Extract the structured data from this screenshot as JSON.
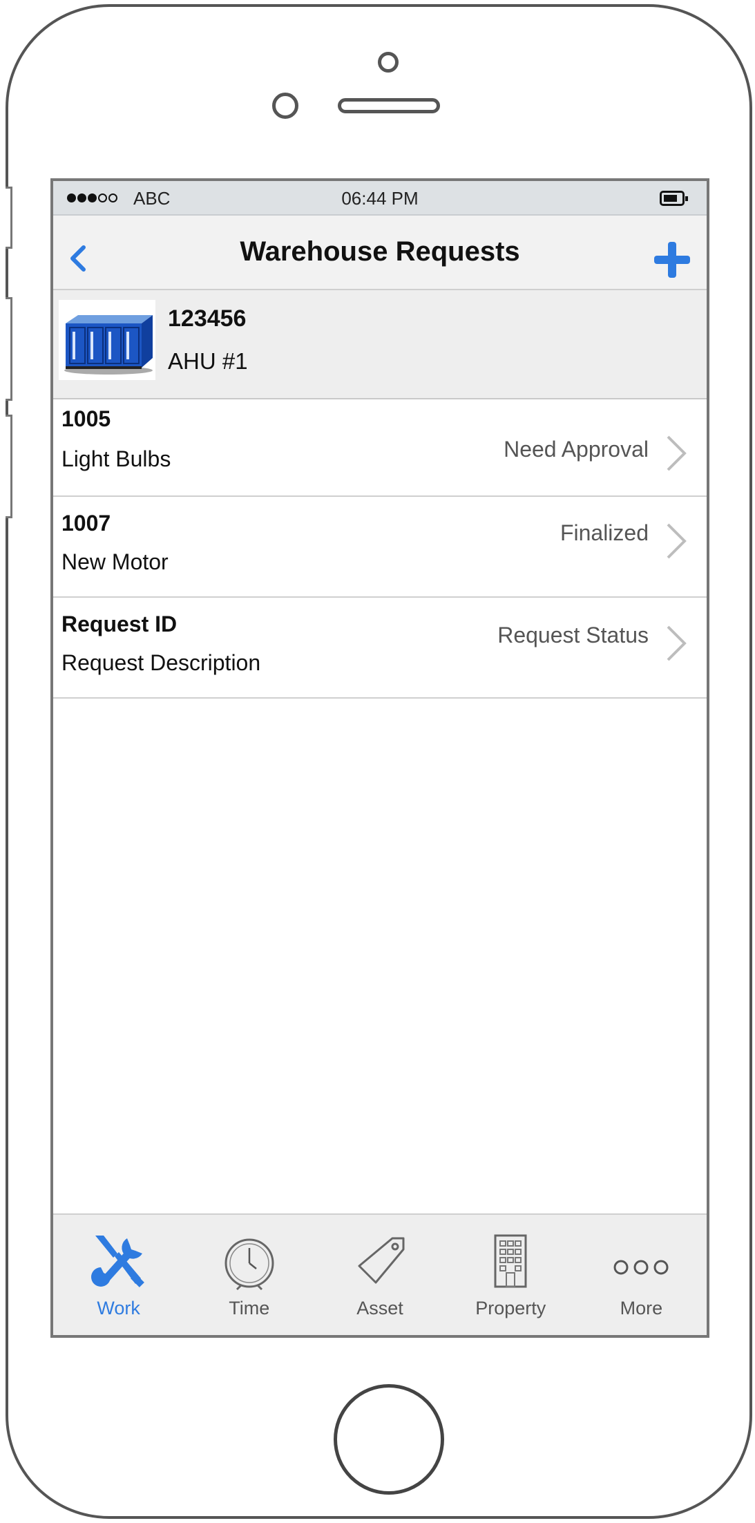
{
  "status_bar": {
    "carrier": "ABC",
    "time": "06:44 PM",
    "signal": [
      true,
      true,
      true,
      false,
      false
    ]
  },
  "nav": {
    "title": "Warehouse Requests",
    "back_icon": "chevron-left-icon",
    "add_icon": "plus-icon",
    "accent_color": "#2e7be0"
  },
  "asset": {
    "id": "123456",
    "name": "AHU #1",
    "thumbnail": "air-handling-unit-image"
  },
  "requests": [
    {
      "id": "1005",
      "description": "Light Bulbs",
      "status": "Need Approval"
    },
    {
      "id": "1007",
      "description": "New Motor",
      "status": "Finalized"
    },
    {
      "id": "Request ID",
      "description": "Request Description",
      "status": "Request Status"
    }
  ],
  "tabs": [
    {
      "label": "Work",
      "icon": "tools-icon",
      "active": true
    },
    {
      "label": "Time",
      "icon": "clock-icon",
      "active": false
    },
    {
      "label": "Asset",
      "icon": "tag-icon",
      "active": false
    },
    {
      "label": "Property",
      "icon": "building-icon",
      "active": false
    },
    {
      "label": "More",
      "icon": "more-icon",
      "active": false
    }
  ]
}
